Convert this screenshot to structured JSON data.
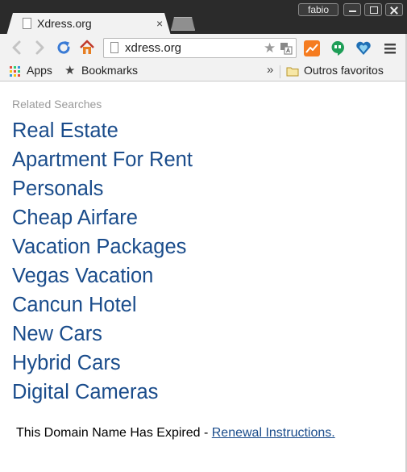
{
  "window": {
    "user_label": "fabio"
  },
  "tab": {
    "title": "Xdress.org",
    "close_glyph": "×"
  },
  "omnibox": {
    "url": "xdress.org"
  },
  "bookmarks_bar": {
    "apps_label": "Apps",
    "bookmarks_label": "Bookmarks",
    "overflow_glyph": "»",
    "other_folder_label": "Outros favoritos"
  },
  "page": {
    "related_title": "Related Searches",
    "links": [
      "Real Estate",
      "Apartment For Rent",
      "Personals",
      "Cheap Airfare",
      "Vacation Packages",
      "Vegas Vacation",
      "Cancun Hotel",
      "New Cars",
      "Hybrid Cars",
      "Digital Cameras"
    ],
    "footer_text": "This Domain Name Has Expired - ",
    "footer_link": "Renewal Instructions."
  },
  "colors": {
    "link": "#1a4c8b",
    "muted": "#9a9a9a",
    "chrome_dark": "#2b2b2b",
    "chrome_light": "#f2f2f2"
  },
  "icons": [
    "back-arrow-icon",
    "forward-arrow-icon",
    "reload-icon",
    "home-icon",
    "page-icon",
    "star-icon",
    "translate-icon",
    "analytics-extension-icon",
    "hangouts-icon",
    "heart-extension-icon",
    "menu-icon",
    "apps-grid-icon",
    "folder-icon"
  ]
}
